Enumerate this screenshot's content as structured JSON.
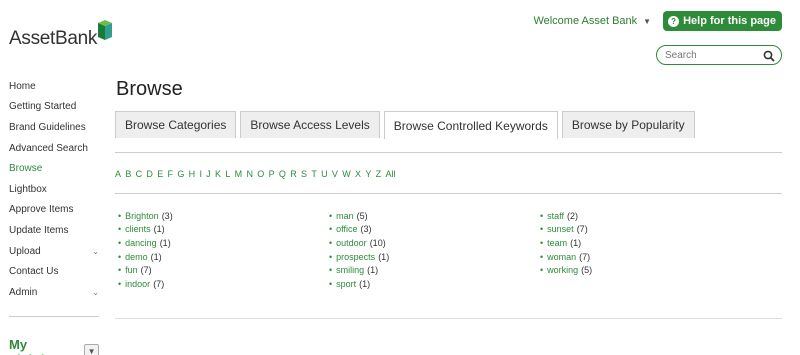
{
  "brand": {
    "logo_text": "AssetBank",
    "accent": "#2e8b3a"
  },
  "header": {
    "welcome": "Welcome Asset Bank",
    "help_label": "Help for this page"
  },
  "search": {
    "placeholder": "Search"
  },
  "sidebar": {
    "items": [
      {
        "label": "Home",
        "active": false,
        "expandable": false
      },
      {
        "label": "Getting Started",
        "active": false,
        "expandable": false
      },
      {
        "label": "Brand Guidelines",
        "active": false,
        "expandable": false
      },
      {
        "label": "Advanced Search",
        "active": false,
        "expandable": false
      },
      {
        "label": "Browse",
        "active": true,
        "expandable": false
      },
      {
        "label": "Lightbox",
        "active": false,
        "expandable": false
      },
      {
        "label": "Approve Items",
        "active": false,
        "expandable": false
      },
      {
        "label": "Update Items",
        "active": false,
        "expandable": false
      },
      {
        "label": "Upload",
        "active": false,
        "expandable": true
      },
      {
        "label": "Contact Us",
        "active": false,
        "expandable": false
      },
      {
        "label": "Admin",
        "active": false,
        "expandable": true
      }
    ],
    "lightbox_title": "My Lightbox"
  },
  "main": {
    "title": "Browse",
    "tabs": [
      {
        "label": "Browse Categories",
        "active": false
      },
      {
        "label": "Browse Access Levels",
        "active": false
      },
      {
        "label": "Browse Controlled Keywords",
        "active": true
      },
      {
        "label": "Browse by Popularity",
        "active": false
      }
    ],
    "alphabet": [
      "A",
      "B",
      "C",
      "D",
      "E",
      "F",
      "G",
      "H",
      "I",
      "J",
      "K",
      "L",
      "M",
      "N",
      "O",
      "P",
      "Q",
      "R",
      "S",
      "T",
      "U",
      "V",
      "W",
      "X",
      "Y",
      "Z",
      "All"
    ],
    "keyword_columns": [
      [
        {
          "name": "Brighton",
          "count": "(3)"
        },
        {
          "name": "clients",
          "count": "(1)"
        },
        {
          "name": "dancing",
          "count": "(1)"
        },
        {
          "name": "demo",
          "count": "(1)"
        },
        {
          "name": "fun",
          "count": "(7)"
        },
        {
          "name": "indoor",
          "count": "(7)"
        }
      ],
      [
        {
          "name": "man",
          "count": "(5)"
        },
        {
          "name": "office",
          "count": "(3)"
        },
        {
          "name": "outdoor",
          "count": "(10)"
        },
        {
          "name": "prospects",
          "count": "(1)"
        },
        {
          "name": "smiling",
          "count": "(1)"
        },
        {
          "name": "sport",
          "count": "(1)"
        }
      ],
      [
        {
          "name": "staff",
          "count": "(2)"
        },
        {
          "name": "sunset",
          "count": "(7)"
        },
        {
          "name": "team",
          "count": "(1)"
        },
        {
          "name": "woman",
          "count": "(7)"
        },
        {
          "name": "working",
          "count": "(5)"
        }
      ]
    ]
  }
}
